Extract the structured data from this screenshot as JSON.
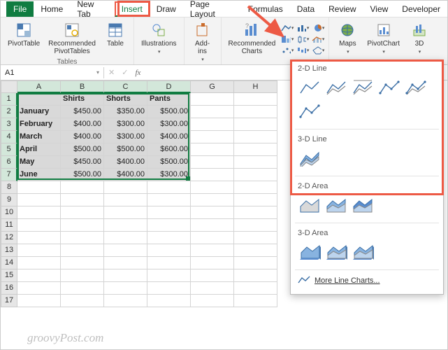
{
  "menu_tabs": [
    "File",
    "Home",
    "New Tab",
    "Insert",
    "Draw",
    "Page Layout",
    "Formulas",
    "Data",
    "Review",
    "View",
    "Developer"
  ],
  "active_tab_index": 3,
  "ribbon": {
    "groups": [
      {
        "name": "tables",
        "label": "Tables",
        "buttons": [
          "PivotTable",
          "Recommended\nPivotTables",
          "Table"
        ]
      },
      {
        "name": "illustrations",
        "label": "",
        "buttons": [
          "Illustrations"
        ]
      },
      {
        "name": "addins",
        "label": "",
        "buttons": [
          "Add-\nins"
        ]
      },
      {
        "name": "charts",
        "label": "",
        "buttons": [
          "Recommended\nCharts"
        ]
      },
      {
        "name": "charts2",
        "label": "",
        "buttons": [
          "Maps",
          "PivotChart",
          "3D"
        ]
      }
    ]
  },
  "namebox": "A1",
  "columns_visible": [
    "A",
    "B",
    "C",
    "D",
    "G",
    "H"
  ],
  "selected_cols": [
    "A",
    "B",
    "C",
    "D"
  ],
  "row_count_visible": 17,
  "selected_rows": [
    1,
    2,
    3,
    4,
    5,
    6,
    7
  ],
  "table": {
    "headers": [
      "",
      "Shirts",
      "Shorts",
      "Pants"
    ],
    "rows": [
      [
        "January",
        "$450.00",
        "$350.00",
        "$500.00"
      ],
      [
        "February",
        "$400.00",
        "$300.00",
        "$300.00"
      ],
      [
        "March",
        "$400.00",
        "$300.00",
        "$400.00"
      ],
      [
        "April",
        "$500.00",
        "$500.00",
        "$600.00"
      ],
      [
        "May",
        "$450.00",
        "$400.00",
        "$500.00"
      ],
      [
        "June",
        "$500.00",
        "$400.00",
        "$300.00"
      ]
    ]
  },
  "chart_panel": {
    "sections": [
      {
        "title": "2-D Line",
        "icons": [
          "line",
          "line-stacked",
          "line-100",
          "line-markers",
          "line-stacked-markers",
          "line-scatter"
        ]
      },
      {
        "title": "3-D Line",
        "icons": [
          "line-3d"
        ]
      },
      {
        "title": "2-D Area",
        "icons": [
          "area",
          "area-stacked",
          "area-100"
        ]
      },
      {
        "title": "3-D Area",
        "icons": [
          "area-3d",
          "area-3d-stacked",
          "area-3d-100"
        ]
      }
    ],
    "more": "More Line Charts..."
  },
  "watermark": "groovyPost.com",
  "chart_data": {
    "type": "table",
    "categories": [
      "January",
      "February",
      "March",
      "April",
      "May",
      "June"
    ],
    "series": [
      {
        "name": "Shirts",
        "values": [
          450.0,
          400.0,
          400.0,
          500.0,
          450.0,
          500.0
        ]
      },
      {
        "name": "Shorts",
        "values": [
          350.0,
          300.0,
          300.0,
          500.0,
          400.0,
          400.0
        ]
      },
      {
        "name": "Pants",
        "values": [
          500.0,
          300.0,
          400.0,
          600.0,
          500.0,
          300.0
        ]
      }
    ]
  }
}
